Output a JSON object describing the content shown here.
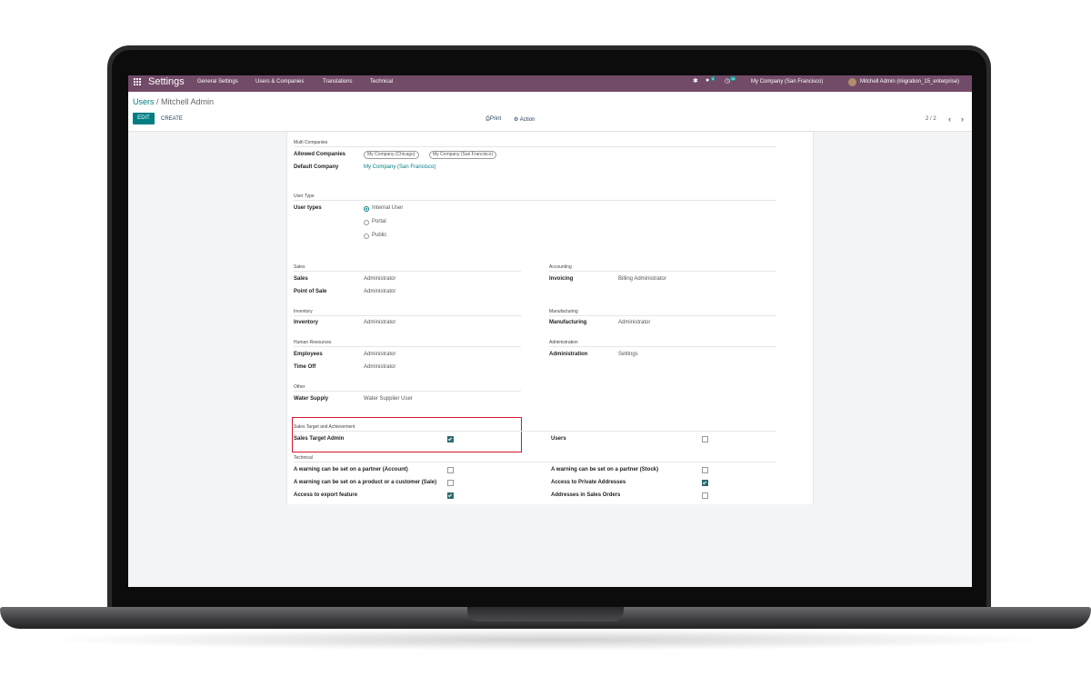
{
  "topbar": {
    "brand": "Settings",
    "menu": [
      "General Settings",
      "Users & Companies",
      "Translations",
      "Technical"
    ],
    "messages_count": "4",
    "activity_count": "16",
    "company": "My Company (San Francisco)",
    "user": "Mitchell Admin (migration_15_enterprise)",
    "color": "#714b67"
  },
  "breadcrumb": {
    "parent": "Users",
    "separator": " / ",
    "current": "Mitchell Admin"
  },
  "toolbar": {
    "edit": "EDIT",
    "create": "CREATE",
    "print": "Print",
    "action": "Action",
    "pager": "2 / 2"
  },
  "multi_companies": {
    "section": "Multi Companies",
    "allowed_label": "Allowed Companies",
    "allowed": [
      "My Company (Chicago)",
      "My Company (San Francisco)"
    ],
    "default_label": "Default Company",
    "default_value": "My Company (San Francisco)"
  },
  "user_type": {
    "section": "User Type",
    "label": "User types",
    "options": [
      "Internal User",
      "Portal",
      "Public"
    ],
    "selected": "Internal User"
  },
  "access_groups": {
    "sales": {
      "section": "Sales",
      "rows": [
        {
          "label": "Sales",
          "value": "Administrator"
        },
        {
          "label": "Point of Sale",
          "value": "Administrator"
        }
      ]
    },
    "accounting": {
      "section": "Accounting",
      "rows": [
        {
          "label": "Invoicing",
          "value": "Billing Administrator"
        }
      ]
    },
    "inventory": {
      "section": "Inventory",
      "rows": [
        {
          "label": "Inventory",
          "value": "Administrator"
        }
      ]
    },
    "manufacturing": {
      "section": "Manufacturing",
      "rows": [
        {
          "label": "Manufacturing",
          "value": "Administrator"
        }
      ]
    },
    "human_resources": {
      "section": "Human Resources",
      "rows": [
        {
          "label": "Employees",
          "value": "Administrator"
        },
        {
          "label": "Time Off",
          "value": "Administrator"
        }
      ]
    },
    "administration": {
      "section": "Administration",
      "rows": [
        {
          "label": "Administration",
          "value": "Settings"
        }
      ]
    },
    "other": {
      "section": "Other",
      "rows": [
        {
          "label": "Water Supply",
          "value": "Water Supplier User"
        }
      ]
    }
  },
  "sales_target": {
    "section": "Sales Target and Achievement",
    "rows": [
      {
        "label": "Sales Target Admin",
        "checked": true
      },
      {
        "label": "Users",
        "checked": false
      }
    ]
  },
  "technical": {
    "section": "Technical",
    "rows": [
      {
        "label": "A warning can be set on a partner (Account)",
        "checked": false
      },
      {
        "label": "A warning can be set on a partner (Stock)",
        "checked": false
      },
      {
        "label": "A warning can be set on a product or a customer (Sale)",
        "checked": false
      },
      {
        "label": "Access to Private Addresses",
        "checked": true
      },
      {
        "label": "Access to export feature",
        "checked": true
      },
      {
        "label": "Addresses in Sales Orders",
        "checked": false
      }
    ]
  }
}
